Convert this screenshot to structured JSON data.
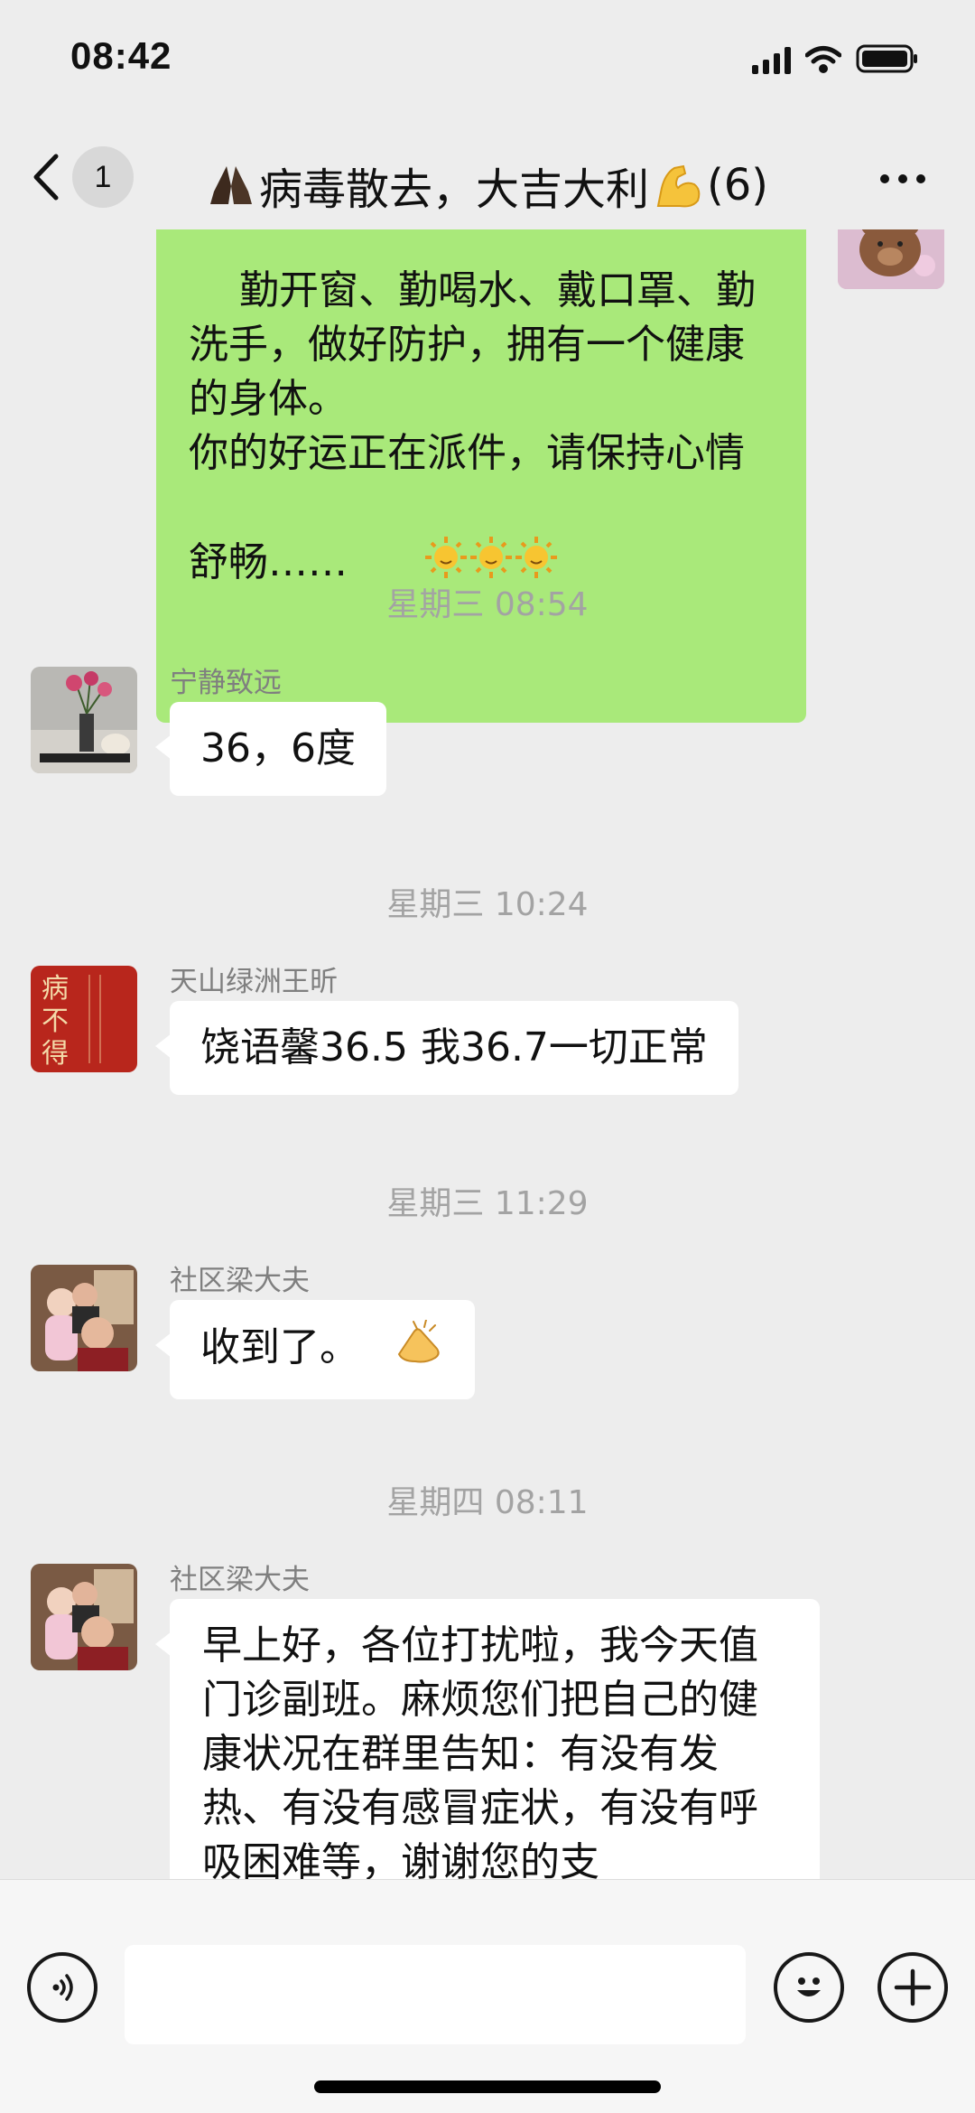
{
  "status_bar": {
    "time": "08:42"
  },
  "header": {
    "back_badge": "1",
    "title": "病毒散去，大吉大利",
    "title_count": "(6)"
  },
  "messages": {
    "mine_text": "勤开窗、勤喝水、戴口罩、勤洗手，做好防护，拥有一个健康的身体。\n你的好运正在派件，请保持心情舒畅……",
    "items": [
      {
        "timestamp": "星期三 08:54",
        "sender": "宁静致远",
        "text": "36，6度"
      },
      {
        "timestamp": "星期三 10:24",
        "sender": "天山绿洲王昕",
        "text": "饶语馨36.5  我36.7一切正常"
      },
      {
        "timestamp": "星期三 11:29",
        "sender": "社区梁大夫",
        "text": "收到了。"
      },
      {
        "timestamp": "星期四 08:11",
        "sender": "社区梁大夫",
        "text": "早上好，各位打扰啦，我今天值门诊副班。麻烦您们把自己的健康状况在群里告知：有没有发热、有没有感冒症状，有没有呼吸困难等，谢谢您的支"
      }
    ]
  },
  "avatar_texts": {
    "calligraphy": "病不得"
  },
  "input_bar": {
    "placeholder": ""
  },
  "icons": {
    "back": "chevron-left-icon",
    "more": "more-dots-icon",
    "voice": "voice-icon",
    "emoji": "emoji-smile-icon",
    "plus": "plus-icon",
    "pray": "praying-hands-emoji",
    "muscle": "flexed-biceps-emoji",
    "sun": "sun-face-emoji",
    "clap": "clapping-hand-emoji"
  },
  "colors": {
    "background": "#ededed",
    "my_bubble": "#a9e97a",
    "their_bubble": "#ffffff",
    "timestamp_text": "#a3a3a3"
  }
}
